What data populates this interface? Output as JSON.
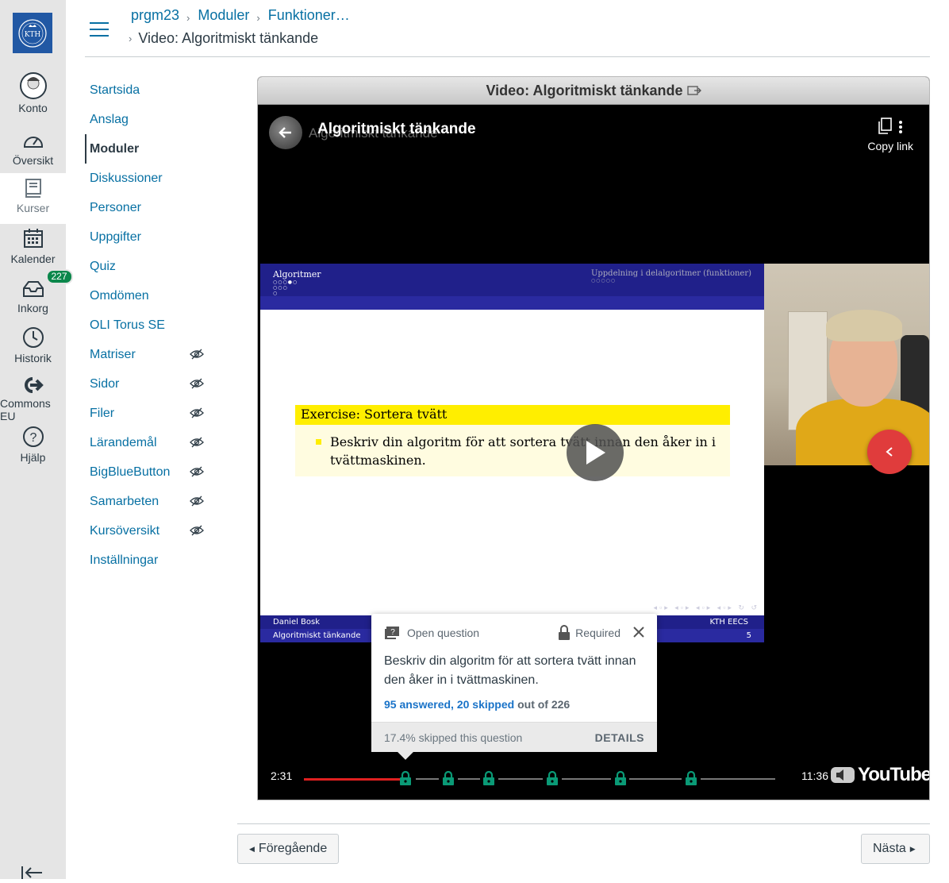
{
  "global_nav": {
    "items": [
      {
        "label": "Konto",
        "icon": "account-icon"
      },
      {
        "label": "Översikt",
        "icon": "dashboard-icon"
      },
      {
        "label": "Kurser",
        "icon": "courses-icon"
      },
      {
        "label": "Kalender",
        "icon": "calendar-icon"
      },
      {
        "label": "Inkorg",
        "icon": "inbox-icon",
        "badge": "227"
      },
      {
        "label": "Historik",
        "icon": "history-icon"
      },
      {
        "label": "Commons EU",
        "icon": "commons-icon"
      },
      {
        "label": "Hjälp",
        "icon": "help-icon"
      }
    ]
  },
  "breadcrumb": {
    "course": "prgm23",
    "modules": "Moduler",
    "section": "Funktioner…",
    "current": "Video: Algoritmiskt tänkande"
  },
  "course_nav": [
    {
      "label": "Startsida",
      "hidden": false
    },
    {
      "label": "Anslag",
      "hidden": false
    },
    {
      "label": "Moduler",
      "hidden": false,
      "active": true
    },
    {
      "label": "Diskussioner",
      "hidden": false
    },
    {
      "label": "Personer",
      "hidden": false
    },
    {
      "label": "Uppgifter",
      "hidden": false
    },
    {
      "label": "Quiz",
      "hidden": false
    },
    {
      "label": "Omdömen",
      "hidden": false
    },
    {
      "label": "OLI Torus SE",
      "hidden": false
    },
    {
      "label": "Matriser",
      "hidden": true
    },
    {
      "label": "Sidor",
      "hidden": true
    },
    {
      "label": "Filer",
      "hidden": true
    },
    {
      "label": "Lärandemål",
      "hidden": true
    },
    {
      "label": "BigBlueButton",
      "hidden": true
    },
    {
      "label": "Samarbeten",
      "hidden": true
    },
    {
      "label": "Kursöversikt",
      "hidden": true
    },
    {
      "label": "Inställningar",
      "hidden": false
    }
  ],
  "video": {
    "frame_title": "Video: Algoritmiskt tänkande",
    "player_title": "Algoritmiskt tänkande",
    "copy_link": "Copy link",
    "current_time": "2:31",
    "duration": "11:36",
    "progress": 0.217,
    "brand": "YouTube",
    "slide": {
      "header_left": "Algoritmer",
      "header_right": "Uppdelning i delalgoritmer (funktioner)",
      "exercise_title": "Exercise: Sortera tvätt",
      "exercise_text": "Beskriv din algoritm för att sortera tvätt innan den åker in i tvättmaskinen.",
      "footer_author": "Daniel Bosk",
      "footer_org": "KTH EECS",
      "footer_title": "Algoritmiskt tänkande",
      "footer_page": "5"
    },
    "question": {
      "type": "Open question",
      "required": "Required",
      "text": "Beskriv din algoritm för att sortera tvätt innan den åker in i tvättmaskinen.",
      "answered": "95 answered, 20 skipped",
      "out_of": "out of 226",
      "skipped_note": "17.4% skipped this question",
      "details": "DETAILS"
    },
    "lock_color": "#0a9a76"
  },
  "footer_nav": {
    "prev": "Föregående",
    "next": "Nästa"
  }
}
